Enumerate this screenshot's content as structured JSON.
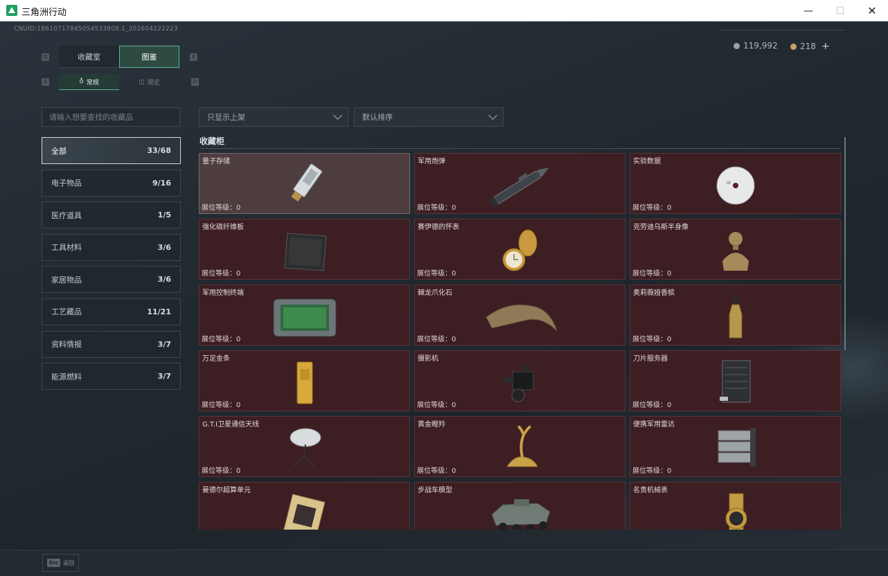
{
  "window": {
    "title": "三角洲行动",
    "minimize": "—",
    "maximize": "☐",
    "close": "✕"
  },
  "header": {
    "uid": "CNUID:18610717845054533808.1_202604222223",
    "currency_silver": "119,992",
    "currency_gold": "218",
    "add": "+"
  },
  "tabs": {
    "key_left": "Q",
    "key_right": "E",
    "items": [
      {
        "label": "收藏室",
        "active": false
      },
      {
        "label": "图鉴",
        "active": true
      }
    ]
  },
  "subtabs": {
    "key_left": "A",
    "key_right": "D",
    "items": [
      {
        "label": "常规",
        "icon": "flame-icon",
        "active": true
      },
      {
        "label": "限定",
        "icon": "limited-icon",
        "active": false
      }
    ]
  },
  "search": {
    "placeholder": "请输入想要查找的收藏品"
  },
  "categories": [
    {
      "label": "全部",
      "count": "33/68",
      "active": true
    },
    {
      "label": "电子物品",
      "count": "9/16"
    },
    {
      "label": "医疗道具",
      "count": "1/5"
    },
    {
      "label": "工具材料",
      "count": "3/6"
    },
    {
      "label": "家居物品",
      "count": "3/6"
    },
    {
      "label": "工艺藏品",
      "count": "11/21"
    },
    {
      "label": "资料情报",
      "count": "3/7"
    },
    {
      "label": "能源燃料",
      "count": "3/7"
    }
  ],
  "filters": {
    "shelf": "只显示上架",
    "sort": "默认排序"
  },
  "section": {
    "title": "收藏柜"
  },
  "cards": [
    {
      "name": "量子存储",
      "level": "展位等级：0",
      "icon": "usb-drive-icon",
      "selected": true
    },
    {
      "name": "军用炮弹",
      "level": "展位等级：0",
      "icon": "artillery-shell-icon"
    },
    {
      "name": "实验数据",
      "level": "展位等级：0",
      "icon": "disc-icon"
    },
    {
      "name": "强化碳纤维板",
      "level": "展位等级：0",
      "icon": "carbon-plate-icon"
    },
    {
      "name": "赛伊德的怀表",
      "level": "展位等级：0",
      "icon": "pocket-watch-icon"
    },
    {
      "name": "克劳迪乌斯半身像",
      "level": "展位等级：0",
      "icon": "bust-statue-icon"
    },
    {
      "name": "军用控制终端",
      "level": "展位等级：0",
      "icon": "control-terminal-icon"
    },
    {
      "name": "棘龙爪化石",
      "level": "展位等级：0",
      "icon": "claw-fossil-icon"
    },
    {
      "name": "奥莉薇娅香槟",
      "level": "展位等级：0",
      "icon": "champagne-bottle-icon"
    },
    {
      "name": "万足金条",
      "level": "展位等级：0",
      "icon": "gold-bar-icon"
    },
    {
      "name": "摄影机",
      "level": "展位等级：0",
      "icon": "camera-icon"
    },
    {
      "name": "刀片服务器",
      "level": "展位等级：0",
      "icon": "server-icon"
    },
    {
      "name": "G.T.I卫星通信天线",
      "level": "展位等级：0",
      "icon": "satellite-dish-icon"
    },
    {
      "name": "黄金瞪羚",
      "level": "展位等级：0",
      "icon": "gold-gazelle-icon"
    },
    {
      "name": "便携军用雷达",
      "level": "展位等级：0",
      "icon": "radar-icon"
    },
    {
      "name": "曼德尔超算单元",
      "level": "",
      "icon": "cpu-unit-icon"
    },
    {
      "name": "步战车模型",
      "level": "",
      "icon": "ifv-model-icon"
    },
    {
      "name": "名贵机械表",
      "level": "",
      "icon": "wristwatch-icon"
    }
  ],
  "footer": {
    "esc_key": "Esc",
    "esc_label": "返回"
  }
}
